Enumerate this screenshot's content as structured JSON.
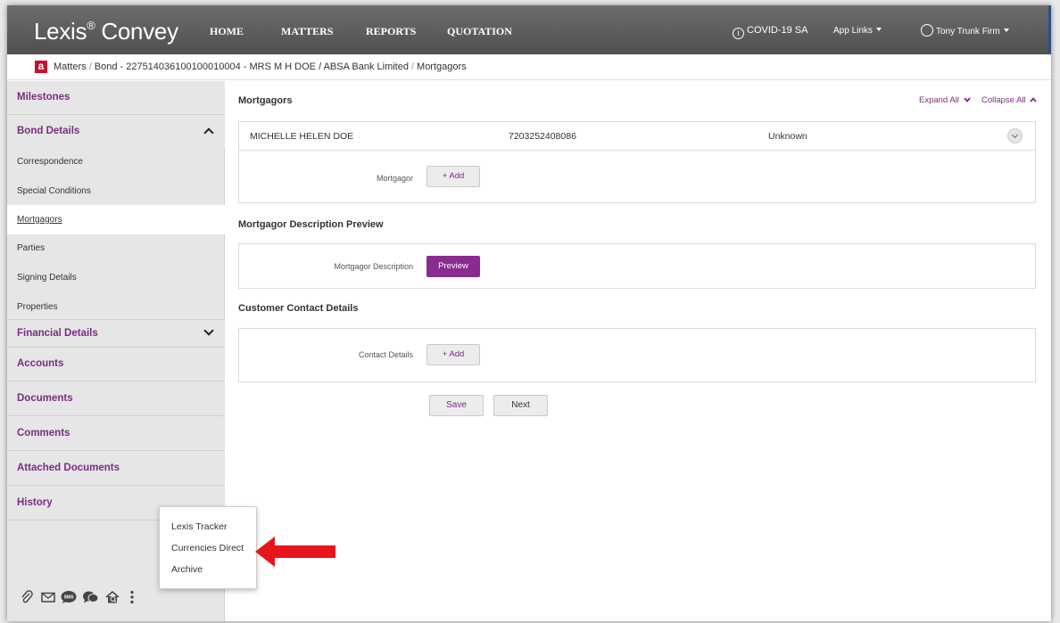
{
  "app": {
    "logo": "Lexis",
    "logo_sup": "®",
    "logo_suffix": " Convey"
  },
  "nav": {
    "items": [
      "HOME",
      "MATTERS",
      "REPORTS",
      "QUOTATION"
    ],
    "covid": "COVID-19 SA",
    "app_links": "App Links",
    "user": "Tony Trunk Firm"
  },
  "breadcrumb": {
    "icon": "a",
    "parts": [
      "Matters",
      "Bond - 227514036100100010004 - MRS M H DOE / ABSA Bank Limited",
      "Mortgagors"
    ]
  },
  "sidebar": {
    "milestones": "Milestones",
    "bond_details": "Bond Details",
    "bond_sub": [
      "Correspondence",
      "Special Conditions",
      "Mortgagors",
      "Parties",
      "Signing Details",
      "Properties"
    ],
    "active_sub": "Mortgagors",
    "financial_details": "Financial Details",
    "accounts": "Accounts",
    "documents": "Documents",
    "comments": "Comments",
    "attached_documents": "Attached Documents",
    "history": "History",
    "icons": [
      "paperclip-icon",
      "envelope-icon",
      "sms-icon",
      "chat-icon",
      "house-search-icon",
      "more-vertical-icon"
    ]
  },
  "popup_menu": {
    "items": [
      "Lexis Tracker",
      "Currencies Direct",
      "Archive"
    ]
  },
  "annotation": {
    "arrow_color": "#e8141b"
  },
  "main": {
    "mortgagors_title": "Mortgagors",
    "expand_all": "Expand All",
    "collapse_all": "Collapse All",
    "mortgagor_row": {
      "name": "MICHELLE HELEN DOE",
      "id_number": "7203252408086",
      "status": "Unknown"
    },
    "mortgagor_label": "Mortgagor",
    "add_label": "+ Add",
    "preview_title": "Mortgagor Description Preview",
    "description_label": "Mortgagor Description",
    "preview_button": "Preview",
    "contact_title": "Customer Contact Details",
    "contact_label": "Contact Details",
    "save_button": "Save",
    "next_button": "Next"
  },
  "colors": {
    "brand_purple": "#7b2c83",
    "button_purple": "#8a2b8f",
    "nav_bg": "#5e5e5e",
    "breadcrumb_icon": "#c8102e"
  }
}
